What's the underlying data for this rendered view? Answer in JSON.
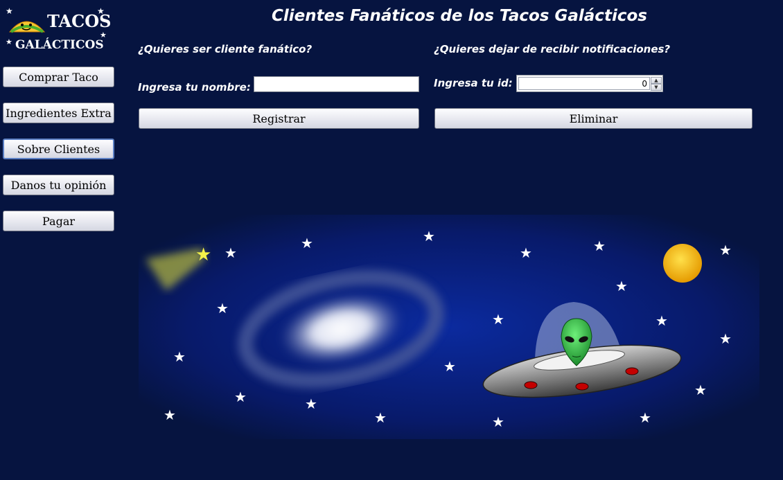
{
  "logo": {
    "line1": "TACOS",
    "line2": "GALÁCTICOS"
  },
  "sidebar": {
    "items": [
      {
        "label": "Comprar Taco"
      },
      {
        "label": "Ingredientes Extra"
      },
      {
        "label": "Sobre Clientes"
      },
      {
        "label": "Danos tu opinión"
      },
      {
        "label": "Pagar"
      }
    ]
  },
  "page": {
    "title": "Clientes Fanáticos de los Tacos Galácticos"
  },
  "register": {
    "heading": "¿Quieres ser cliente fanático?",
    "name_label": "Ingresa tu nombre:",
    "name_value": "",
    "button": "Registrar"
  },
  "unsubscribe": {
    "heading": "¿Quieres dejar de recibir notificaciones?",
    "id_label": "Ingresa tu id:",
    "id_value": "0",
    "button": "Eliminar"
  },
  "colors": {
    "background": "#061440",
    "star": "#ffffff",
    "comet": "#f4f24a",
    "sun": "#f5b300"
  }
}
